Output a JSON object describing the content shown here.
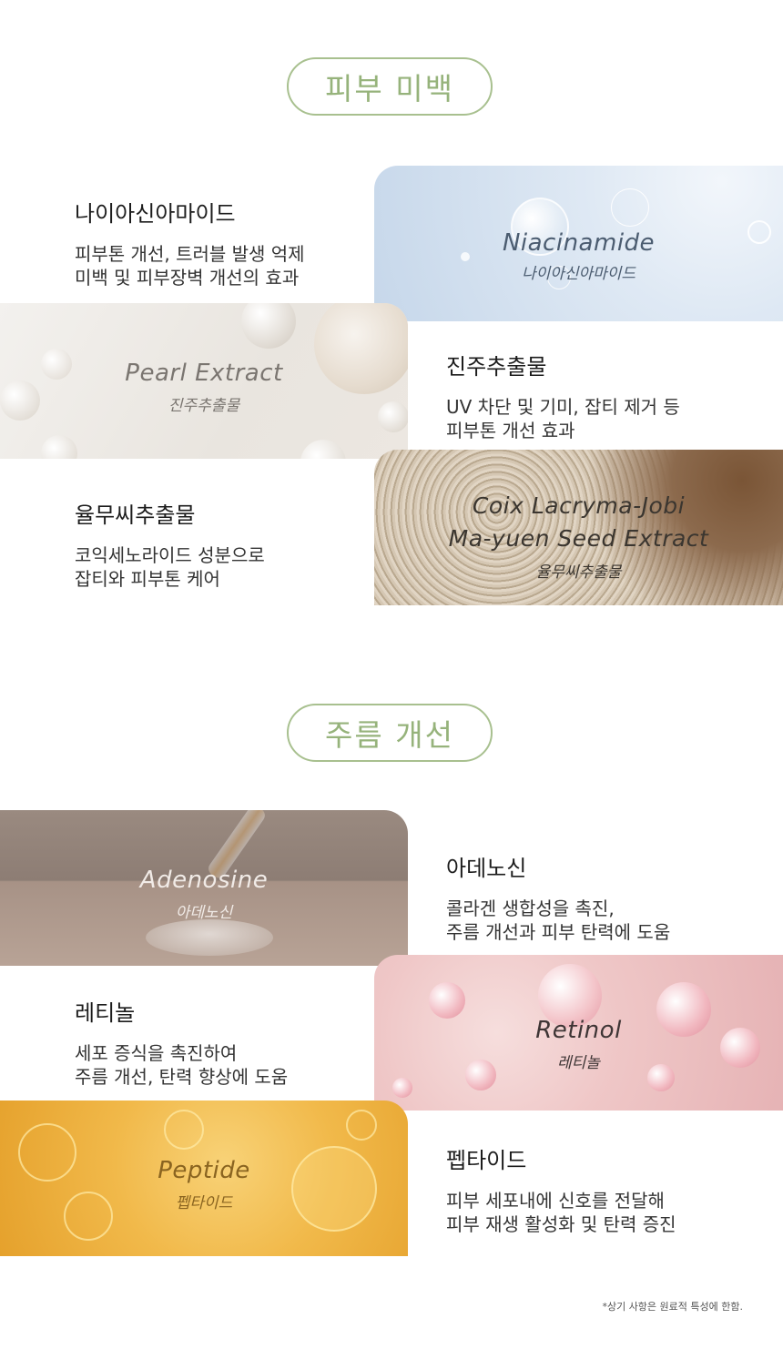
{
  "sections": [
    {
      "title": "피부 미백",
      "items": [
        {
          "name": "나이아신아마이드",
          "desc": [
            "피부톤 개선, 트러블 발생 억제",
            "미백 및 피부장벽 개선의 효과"
          ],
          "en": "Niacinamide",
          "ko": "나이아신아마이드"
        },
        {
          "name": "진주추출물",
          "desc": [
            "UV 차단 및 기미, 잡티 제거 등",
            "피부톤 개선 효과"
          ],
          "en": "Pearl Extract",
          "ko": "진주추출물"
        },
        {
          "name": "율무씨추출물",
          "desc": [
            "코익세노라이드 성분으로",
            "잡티와 피부톤 케어"
          ],
          "en": [
            "Coix Lacryma-Jobi",
            "Ma-yuen Seed Extract"
          ],
          "ko": "율무씨추출물"
        }
      ]
    },
    {
      "title": "주름 개선",
      "items": [
        {
          "name": "아데노신",
          "desc": [
            "콜라겐 생합성을 촉진,",
            "주름 개선과 피부 탄력에 도움"
          ],
          "en": "Adenosine",
          "ko": "아데노신"
        },
        {
          "name": "레티놀",
          "desc": [
            "세포 증식을 촉진하여",
            "주름 개선, 탄력 향상에 도움"
          ],
          "en": "Retinol",
          "ko": "레티놀"
        },
        {
          "name": "펩타이드",
          "desc": [
            "피부 세포내에 신호를 전달해",
            "피부 재생 활성화 및 탄력 증진"
          ],
          "en": "Peptide",
          "ko": "펩타이드"
        }
      ]
    }
  ],
  "footnote": "*상기 사항은 원료적 특성에 한함."
}
